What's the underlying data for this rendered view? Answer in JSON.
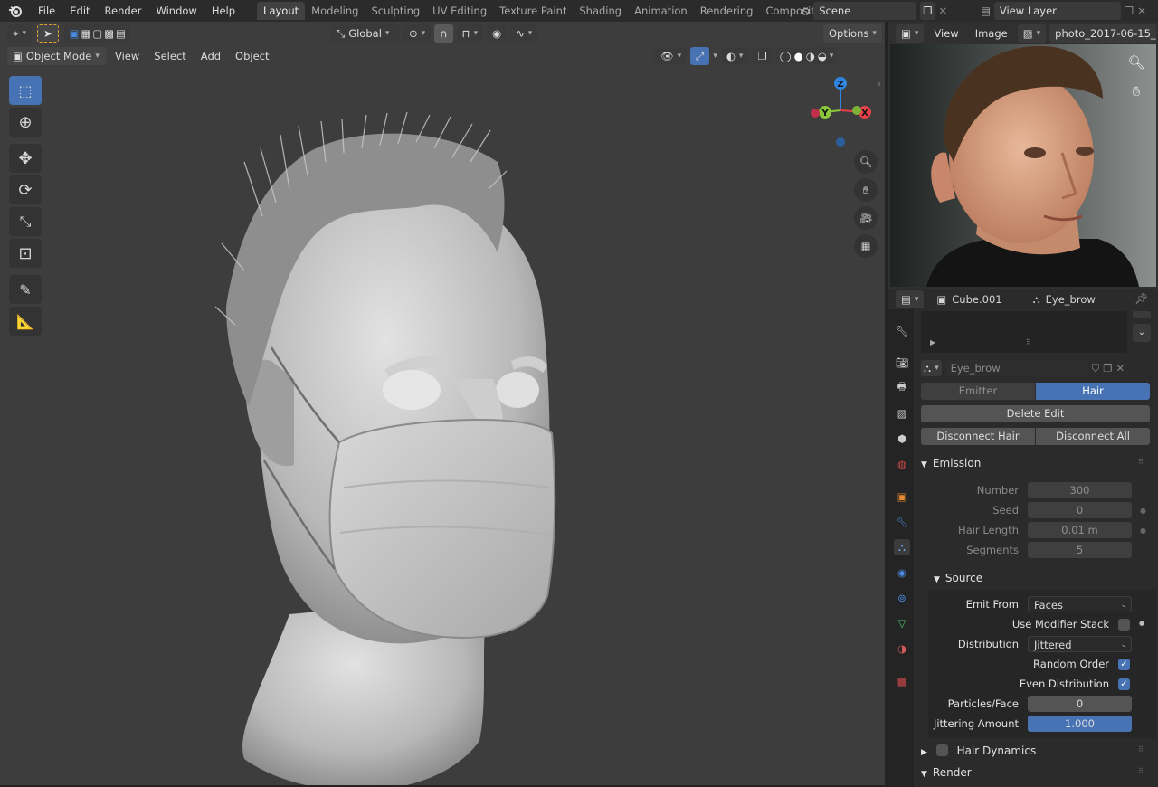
{
  "menus": [
    "File",
    "Edit",
    "Render",
    "Window",
    "Help"
  ],
  "workspaces": [
    "Layout",
    "Modeling",
    "Sculpting",
    "UV Editing",
    "Texture Paint",
    "Shading",
    "Animation",
    "Rendering",
    "Compositing"
  ],
  "scene": "Scene",
  "view_layer": "View Layer",
  "viewport": {
    "mode": "Object Mode",
    "menus": [
      "View",
      "Select",
      "Add",
      "Object"
    ],
    "orientation": "Global",
    "options": "Options",
    "gizmo_axes": [
      "Z",
      "Y",
      "X"
    ]
  },
  "image_editor": {
    "menus": [
      "View",
      "Image"
    ],
    "image_name": "photo_2017-06-15_..."
  },
  "properties": {
    "object": "Cube.001",
    "particle_system": "Eye_brow",
    "settings_name": "Eye_brow",
    "types": [
      "Emitter",
      "Hair"
    ],
    "active_type": "Hair",
    "delete_edit": "Delete Edit",
    "disconnect_hair": "Disconnect Hair",
    "disconnect_all": "Disconnect All",
    "emission": {
      "title": "Emission",
      "number_label": "Number",
      "number": "300",
      "seed_label": "Seed",
      "seed": "0",
      "hair_length_label": "Hair Length",
      "hair_length": "0.01 m",
      "segments_label": "Segments",
      "segments": "5"
    },
    "source": {
      "title": "Source",
      "emit_from_label": "Emit From",
      "emit_from": "Faces",
      "use_modifier_stack": "Use Modifier Stack",
      "distribution_label": "Distribution",
      "distribution": "Jittered",
      "random_order": "Random Order",
      "even_distribution": "Even Distribution",
      "particles_face_label": "Particles/Face",
      "particles_face": "0",
      "jitter_label": "Jittering Amount",
      "jitter": "1.000",
      "jitter_fill": 1.0
    },
    "hair_dynamics": "Hair Dynamics",
    "render": "Render"
  },
  "colors": {
    "accent": "#4772b3",
    "x_axis": "#e8404b",
    "y_axis": "#8bc73a",
    "z_axis": "#2f86e0"
  }
}
